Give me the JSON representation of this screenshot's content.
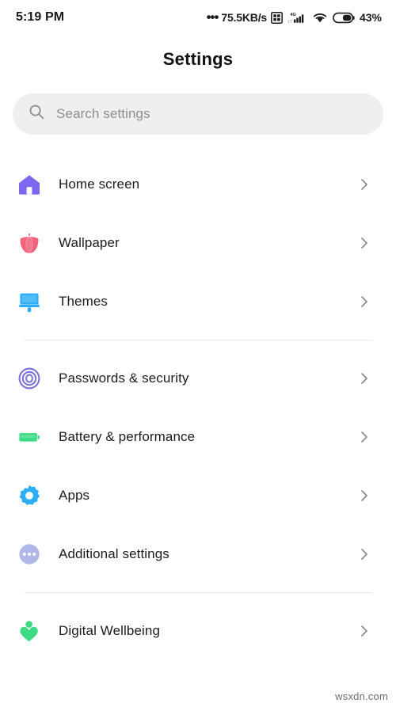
{
  "status_bar": {
    "time": "5:19 PM",
    "net_dots": "•••",
    "network_speed": "75.5KB/s",
    "sim_icon": "sim-card-icon",
    "signal_icon": "signal-4g-icon",
    "signal_label": "4G",
    "wifi_icon": "wifi-icon",
    "battery_icon": "battery-icon",
    "battery_percent": "43%"
  },
  "header": {
    "title": "Settings"
  },
  "search": {
    "icon": "search-icon",
    "placeholder": "Search settings",
    "value": ""
  },
  "groups": [
    {
      "items": [
        {
          "label": "Home screen",
          "icon": "home-icon",
          "color": "#7B68EE",
          "chevron": "chevron-right-icon"
        },
        {
          "label": "Wallpaper",
          "icon": "tulip-flower-icon",
          "color": "#F2637E",
          "chevron": "chevron-right-icon"
        },
        {
          "label": "Themes",
          "icon": "paint-brush-icon",
          "color": "#2BAEF5",
          "chevron": "chevron-right-icon"
        }
      ]
    },
    {
      "items": [
        {
          "label": "Passwords & security",
          "icon": "fingerprint-icon",
          "color": "#7B73D4",
          "chevron": "chevron-right-icon"
        },
        {
          "label": "Battery & performance",
          "icon": "battery-icon",
          "color": "#3DDC84",
          "chevron": "chevron-right-icon"
        },
        {
          "label": "Apps",
          "icon": "gear-icon",
          "color": "#2BAEF5",
          "chevron": "chevron-right-icon"
        },
        {
          "label": "Additional settings",
          "icon": "more-dots-icon",
          "color": "#AFB6E8",
          "chevron": "chevron-right-icon"
        }
      ]
    },
    {
      "items": [
        {
          "label": "Digital Wellbeing",
          "icon": "person-heart-icon",
          "color": "#3DDC84",
          "chevron": "chevron-right-icon"
        }
      ]
    }
  ],
  "watermark": "wsxdn.com",
  "colors": {
    "background": "#FFFFFF",
    "search_background": "#EFEFEF",
    "divider": "#ECECEC",
    "text_primary": "#1C1C1C",
    "text_placeholder": "#8E8E8E",
    "chevron": "#8A8A8A"
  }
}
